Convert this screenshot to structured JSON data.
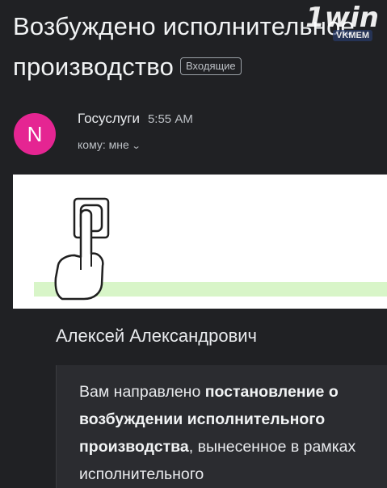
{
  "subject": {
    "title": "Возбуждено исполнительное производство",
    "label": "Входящие"
  },
  "watermark": {
    "logo_text": "1win",
    "sub_text": "VKMEM"
  },
  "sender": {
    "avatar_letter": "N",
    "name": "Госуслуги",
    "time": "5:55 AM",
    "recipient": "кому: мне",
    "recipient_icon": "chevron-down-icon"
  },
  "banner": {
    "icon": "hand-pressing-switch-icon",
    "stripe_color": "#d8f5c8"
  },
  "body": {
    "greeting": "Алексей Александрович",
    "text_1": "Вам направлено ",
    "text_bold": "постановление о возбуждении исполнительного производства",
    "text_2": ", вынесенное в рамках исполнительного"
  },
  "colors": {
    "background": "#202124",
    "avatar": "#e52592",
    "quote_box": "#2b2c30"
  }
}
